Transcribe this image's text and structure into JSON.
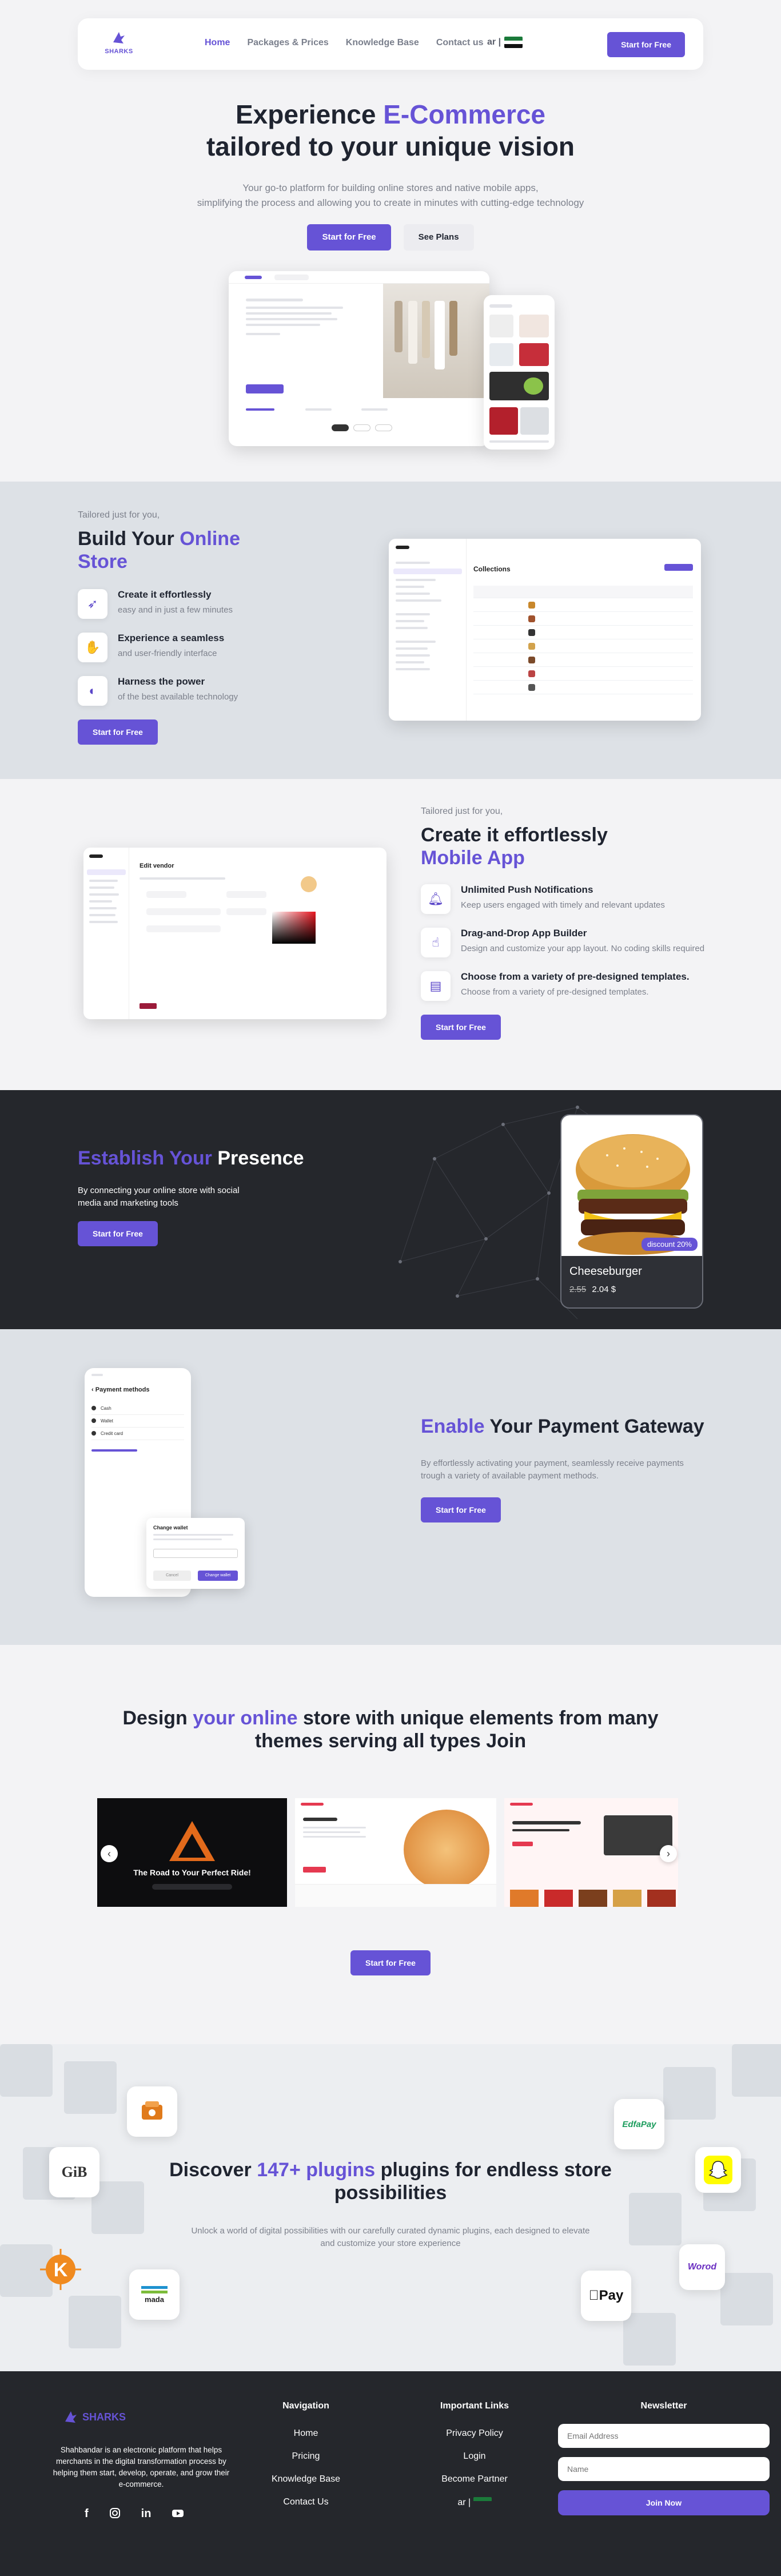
{
  "brand": {
    "name": "SHARKS",
    "accent": "#6653d6",
    "dark": "#25272c"
  },
  "nav": {
    "links": [
      "Home",
      "Packages & Prices",
      "Knowledge Base",
      "Contact us"
    ],
    "lang": "ar |",
    "cta": "Start for Free"
  },
  "hero": {
    "title_a": "Experience ",
    "title_highlight": "E-Commerce",
    "title_b": "tailored to your unique vision",
    "subtitle_1": "Your go-to platform for building online stores and native mobile apps,",
    "subtitle_2": "simplifying the process and allowing you to create in minutes with cutting-edge technology",
    "primary": "Start for Free",
    "secondary": "See Plans"
  },
  "store": {
    "eyebrow": "Tailored just for you,",
    "title_a": "Build Your ",
    "title_highlight": "Online Store",
    "features": [
      {
        "icon": "rocket-icon",
        "title": "Create it effortlessly",
        "desc": "easy and in just a few minutes"
      },
      {
        "icon": "hand-icon",
        "title": "Experience a seamless",
        "desc": "and user-friendly interface"
      },
      {
        "icon": "gauge-icon",
        "title": "Harness the power",
        "desc": "of the best available technology"
      }
    ],
    "cta": "Start for Free",
    "panel_title": "Collections"
  },
  "app": {
    "eyebrow": "Tailored just for you,",
    "title_a": "Create it effortlessly",
    "title_highlight": "Mobile App",
    "features": [
      {
        "icon": "bell-icon",
        "title": "Unlimited Push Notifications",
        "desc": "Keep users engaged with timely and relevant updates"
      },
      {
        "icon": "drag-icon",
        "title": "Drag-and-Drop App Builder",
        "desc": "Design and customize your app layout. No coding skills required"
      },
      {
        "icon": "template-icon",
        "title": "Choose from a variety of pre-designed templates.",
        "desc": "Choose from a variety of pre-designed templates."
      }
    ],
    "cta": "Start for Free",
    "panel_title": "Edit vendor"
  },
  "presence": {
    "title_highlight": "Establish Your",
    "title_b": " Presence",
    "desc": "By connecting your online store with social media and marketing tools",
    "cta": "Start for Free",
    "product": {
      "badge": "discount 20%",
      "name": "Cheeseburger",
      "old_price": "2.55",
      "new_price": "2.04 $"
    }
  },
  "payment": {
    "title_highlight": "Enable",
    "title_b": " Your Payment Gateway",
    "desc": "By effortlessly activating your payment, seamlessly receive payments trough a variety of available payment methods.",
    "cta": "Start for Free",
    "phone_title": "Payment methods",
    "methods": [
      "Cash",
      "Wallet",
      "Credit card"
    ],
    "dialog_title": "Change wallet",
    "dialog_cancel": "Cancel",
    "dialog_confirm": "Change wallet"
  },
  "themes": {
    "title_a": "Design ",
    "title_highlight": "your online",
    "title_b": " store with unique elements from many themes serving all types Join",
    "slide1": "The Road to Your Perfect Ride!",
    "cta": "Start for Free"
  },
  "plugins": {
    "title_a": "Discover ",
    "title_highlight": "147+ plugins",
    "title_b": " plugins for endless store possibilities",
    "desc": "Unlock a world of digital possibilities with our carefully curated dynamic plugins, each designed to elevate and customize your store experience",
    "logos": {
      "gib": "GiB",
      "edfapay": "EdfaPay",
      "mada": "mada",
      "applepay": "Pay",
      "worod": "Worod"
    }
  },
  "footer": {
    "about": "Shahbandar is an electronic platform that helps merchants in the digital transformation process by helping them start, develop, operate, and grow their e-commerce.",
    "nav_title": "Navigation",
    "nav_items": [
      "Home",
      "Pricing",
      "Knowledge Base",
      "Contact Us"
    ],
    "links_title": "Important Links",
    "links_items": [
      "Privacy Policy",
      "Login",
      "Become Partner"
    ],
    "lang": "ar |",
    "newsletter_title": "Newsletter",
    "email_placeholder": "Email Address",
    "name_placeholder": "Name",
    "join": "Join Now"
  }
}
